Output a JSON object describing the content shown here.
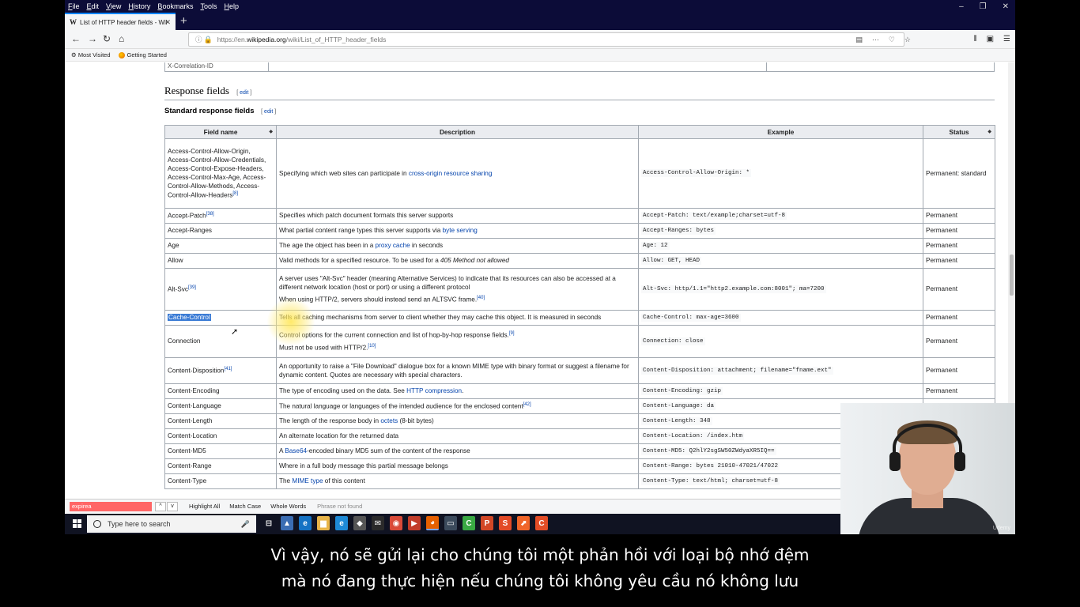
{
  "menu": [
    "File",
    "Edit",
    "View",
    "History",
    "Bookmarks",
    "Tools",
    "Help"
  ],
  "window_controls": {
    "minimize": "–",
    "restore": "❐",
    "close": "✕"
  },
  "tab": {
    "favicon": "W",
    "title": "List of HTTP header fields - Wil",
    "close": "✕",
    "new": "+"
  },
  "nav": {
    "back": "←",
    "forward": "→",
    "reload": "↻",
    "home": "⌂"
  },
  "url": {
    "info": "ⓘ",
    "prefix": "https://en.",
    "domain": "wikipedia.org",
    "path": "/wiki/List_of_HTTP_header_fields"
  },
  "url_icons": [
    "▤",
    "···",
    "♡",
    "☆"
  ],
  "right_icons": [
    "⫴",
    "▣",
    "☰"
  ],
  "bookmarks": {
    "most_visited": "Most Visited",
    "getting_started": "Getting Started"
  },
  "prev_row_text": "X-Correlation-ID",
  "section": {
    "title": "Response fields",
    "edit": "edit"
  },
  "subsection": {
    "title": "Standard response fields",
    "edit": "edit"
  },
  "table": {
    "headers": [
      "Field name",
      "Description",
      "Example",
      "Status"
    ],
    "rows": [
      {
        "name": "Access-Control-Allow-Origin, Access-Control-Allow-Credentials, Access-Control-Expose-Headers, Access-Control-Max-Age, Access-Control-Allow-Methods, Access-Control-Allow-Headers",
        "ref": "[8]",
        "desc_pre": "Specifying which web sites can participate in ",
        "desc_link": "cross-origin resource sharing",
        "desc_post": "",
        "example": "Access-Control-Allow-Origin: *",
        "status": "Permanent: standard"
      },
      {
        "name": "Accept-Patch",
        "ref": "[38]",
        "desc_pre": "Specifies which patch document formats this server supports",
        "desc_link": "",
        "desc_post": "",
        "example": "Accept-Patch: text/example;charset=utf-8",
        "status": "Permanent"
      },
      {
        "name": "Accept-Ranges",
        "ref": "",
        "desc_pre": "What partial content range types this server supports via ",
        "desc_link": "byte serving",
        "desc_post": "",
        "example": "Accept-Ranges: bytes",
        "status": "Permanent"
      },
      {
        "name": "Age",
        "ref": "",
        "desc_pre": "The age the object has been in a ",
        "desc_link": "proxy cache",
        "desc_post": " in seconds",
        "example": "Age: 12",
        "status": "Permanent"
      },
      {
        "name": "Allow",
        "ref": "",
        "desc_pre": "Valid methods for a specified resource. To be used for a ",
        "desc_link": "",
        "desc_post": "405 Method not allowed",
        "example": "Allow: GET, HEAD",
        "status": "Permanent"
      },
      {
        "name": "Alt-Svc",
        "ref": "[39]",
        "desc_pre": "A server uses \"Alt-Svc\" header (meaning Alternative Services) to indicate that its resources can also be accessed at a different network location (host or port) or using a different protocol",
        "desc_link": "",
        "desc_post": "When using HTTP/2, servers should instead send an ALTSVC frame.",
        "desc_ref": "[40]",
        "example": "Alt-Svc: http/1.1=\"http2.example.com:8001\"; ma=7200",
        "status": "Permanent"
      },
      {
        "name": "Cache-Control",
        "ref": "",
        "desc_pre": "Tells all caching mechanisms from server to client whether they may cache this object. It is measured in seconds",
        "desc_link": "",
        "desc_post": "",
        "example": "Cache-Control: max-age=3600",
        "status": "Permanent"
      },
      {
        "name": "Connection",
        "ref": "",
        "desc_pre": "Control options for the current connection and list of hop-by-hop response fields.",
        "desc_ref": "[9]",
        "desc_link": "",
        "desc_post": "Must not be used with HTTP/2.",
        "desc_ref2": "[10]",
        "example": "Connection: close",
        "status": "Permanent"
      },
      {
        "name": "Content-Disposition",
        "ref": "[41]",
        "desc_pre": "An opportunity to raise a \"File Download\" dialogue box for a known MIME type with binary format or suggest a filename for dynamic content. Quotes are necessary with special characters.",
        "desc_link": "",
        "desc_post": "",
        "example": "Content-Disposition: attachment; filename=\"fname.ext\"",
        "status": "Permanent"
      },
      {
        "name": "Content-Encoding",
        "ref": "",
        "desc_pre": "The type of encoding used on the data. See ",
        "desc_link": "HTTP compression",
        "desc_post": ".",
        "example": "Content-Encoding: gzip",
        "status": "Permanent"
      },
      {
        "name": "Content-Language",
        "ref": "",
        "desc_pre": "The natural language or languages of the intended audience for the enclosed content",
        "desc_ref": "[42]",
        "desc_link": "",
        "desc_post": "",
        "example": "Content-Language: da",
        "status": ""
      },
      {
        "name": "Content-Length",
        "ref": "",
        "desc_pre": "The length of the response body in ",
        "desc_link": "octets",
        "desc_post": " (8-bit bytes)",
        "example": "Content-Length: 348",
        "status": ""
      },
      {
        "name": "Content-Location",
        "ref": "",
        "desc_pre": "An alternate location for the returned data",
        "desc_link": "",
        "desc_post": "",
        "example": "Content-Location: /index.htm",
        "status": ""
      },
      {
        "name": "Content-MD5",
        "ref": "",
        "desc_pre": "A ",
        "desc_link": "Base64",
        "desc_post": "-encoded binary MD5 sum of the content of the response",
        "example": "Content-MD5: Q2hlY2sgSW50ZWdyaXR5IQ==",
        "status": ""
      },
      {
        "name": "Content-Range",
        "ref": "",
        "desc_pre": "Where in a full body message this partial message belongs",
        "desc_link": "",
        "desc_post": "",
        "example": "Content-Range: bytes 21010-47021/47022",
        "status": ""
      },
      {
        "name": "Content-Type",
        "ref": "",
        "desc_pre": "The ",
        "desc_link": "MIME type",
        "desc_post": " of this content",
        "example": "Content-Type: text/html; charset=utf-8",
        "status": ""
      }
    ]
  },
  "findbar": {
    "query": "expirea",
    "up": "^",
    "down": "v",
    "highlight_all": "Highlight All",
    "match_case": "Match Case",
    "whole_words": "Whole Words",
    "status": "Phrase not found"
  },
  "taskbar": {
    "search_placeholder": "Type here to search",
    "mic": "🎤",
    "apps": [
      "⊟",
      "▲",
      "e",
      "▆",
      "e",
      "◆",
      "✉",
      "◉",
      "▶",
      "◕",
      "▭",
      "C",
      "P",
      "S",
      "⬈",
      "C"
    ]
  },
  "webcam": {
    "watermark": "Udemy"
  },
  "subtitles": {
    "line1": "Vì vậy, nó sẽ gửi lại cho chúng tôi một phản hồi với loại bộ nhớ đệm",
    "line2": "mà nó đang thực hiện nếu chúng tôi không yêu cầu nó không lưu"
  },
  "colors": {
    "link": "#0645ad",
    "header_bg": "#eaecf0",
    "border": "#a2a9b1",
    "find_error": "#ff6666",
    "selection": "#3a7bd5"
  }
}
